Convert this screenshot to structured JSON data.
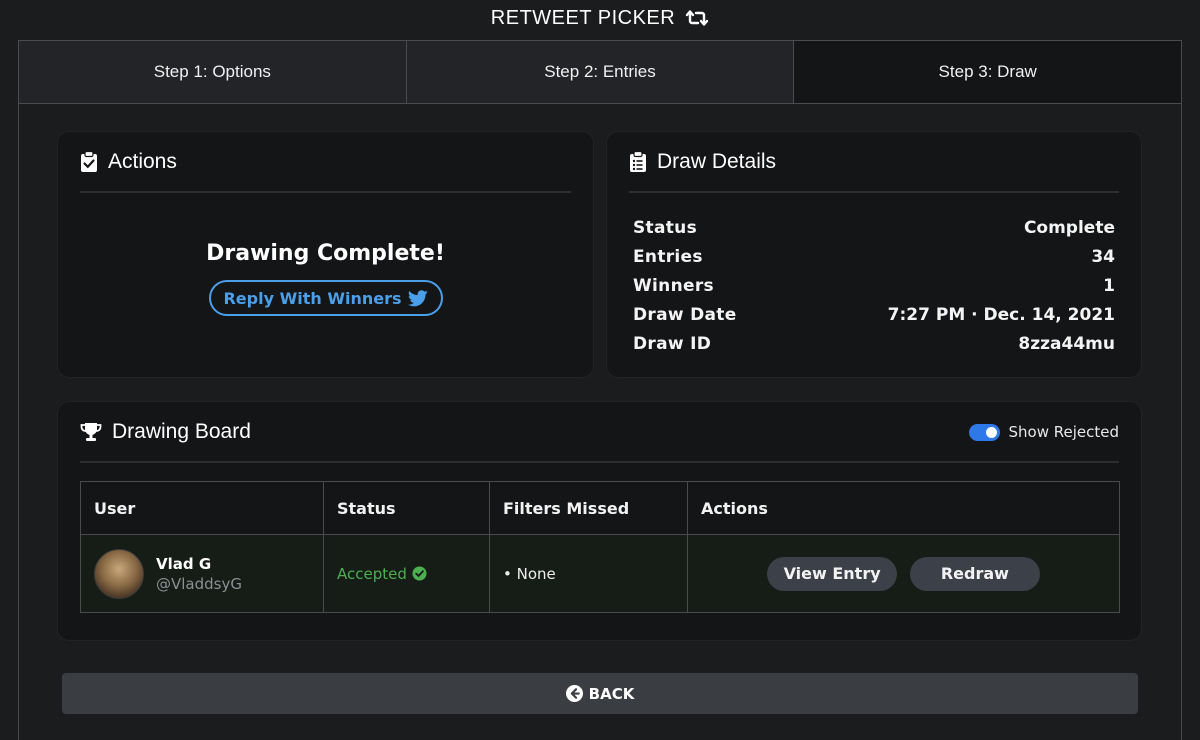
{
  "app": {
    "title": "RETWEET PICKER",
    "title_icon": "retweet-icon"
  },
  "tabs": [
    {
      "label": "Step 1: Options"
    },
    {
      "label": "Step 2: Entries"
    },
    {
      "label": "Step 3: Draw",
      "active": true
    }
  ],
  "actions": {
    "header": "Actions",
    "icon": "clipboard-check-icon",
    "message": "Drawing Complete!",
    "reply_label": "Reply With Winners",
    "reply_icon": "twitter-icon"
  },
  "details": {
    "header": "Draw Details",
    "icon": "clipboard-list-icon",
    "rows": [
      {
        "key": "Status",
        "value": "Complete"
      },
      {
        "key": "Entries",
        "value": "34"
      },
      {
        "key": "Winners",
        "value": "1"
      },
      {
        "key": "Draw Date",
        "value": "7:27 PM · Dec. 14, 2021"
      },
      {
        "key": "Draw ID",
        "value": "8zza44mu"
      }
    ]
  },
  "board": {
    "header": "Drawing Board",
    "icon": "trophy-icon",
    "toggle_label": "Show Rejected",
    "toggle_on": true,
    "columns": [
      "User",
      "Status",
      "Filters Missed",
      "Actions"
    ],
    "rows": [
      {
        "name": "Vlad G",
        "handle": "@VladdsyG",
        "status": "Accepted",
        "filters": "• None",
        "view_label": "View Entry",
        "redraw_label": "Redraw"
      }
    ]
  },
  "back_label": "BACK",
  "colors": {
    "accent": "#4a9fea",
    "success": "#4caf50",
    "toggle": "#2f78e8"
  }
}
